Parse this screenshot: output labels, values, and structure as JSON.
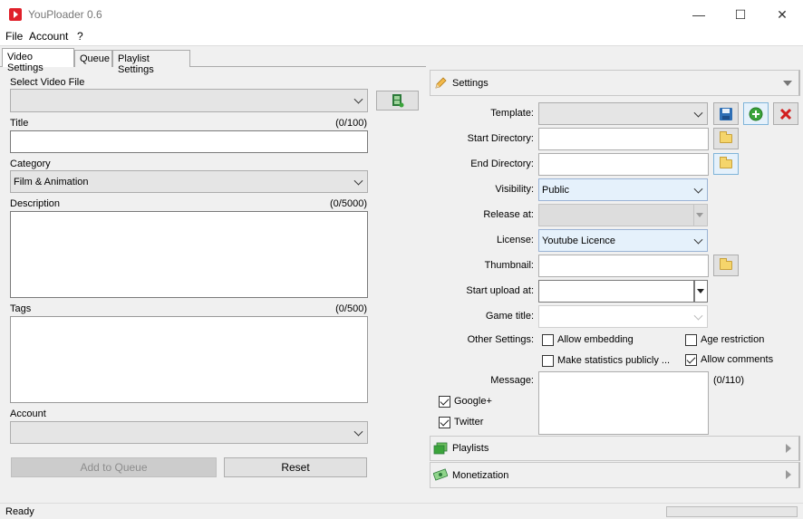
{
  "window": {
    "title": "YouPloader 0.6",
    "minimize": "—",
    "maximize": "☐",
    "close": "✕"
  },
  "menu": [
    "File",
    "Account",
    "?"
  ],
  "tabs": [
    "Video Settings",
    "Queue",
    "Playlist Settings"
  ],
  "left": {
    "select_video_label": "Select Video File",
    "title_label": "Title",
    "title_counter": "(0/100)",
    "category_label": "Category",
    "category_value": "Film & Animation",
    "description_label": "Description",
    "description_counter": "(0/5000)",
    "tags_label": "Tags",
    "tags_counter": "(0/500)",
    "account_label": "Account",
    "add_to_queue": "Add to Queue",
    "reset": "Reset"
  },
  "settings": {
    "header": "Settings",
    "template_label": "Template:",
    "start_dir_label": "Start Directory:",
    "end_dir_label": "End Directory:",
    "visibility_label": "Visibility:",
    "visibility_value": "Public",
    "release_label": "Release at:",
    "license_label": "License:",
    "license_value": "Youtube Licence",
    "thumbnail_label": "Thumbnail:",
    "start_upload_label": "Start upload at:",
    "game_title_label": "Game title:",
    "other_settings_label": "Other Settings:",
    "allow_embedding": "Allow embedding",
    "age_restriction": "Age restriction",
    "make_statistics": "Make statistics publicly ...",
    "allow_comments": "Allow comments",
    "message_label": "Message:",
    "message_counter": "(0/110)",
    "google_plus": "Google+",
    "twitter": "Twitter"
  },
  "sections": {
    "playlists": "Playlists",
    "monetization": "Monetization"
  },
  "status": {
    "text": "Ready"
  },
  "colors": {
    "accent_red": "#e0202a",
    "save_blue": "#2f6fb5",
    "add_green": "#3aa43a",
    "delete_red": "#d21f1f"
  }
}
